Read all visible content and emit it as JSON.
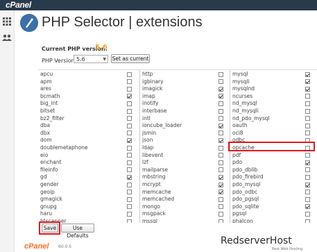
{
  "header": {
    "logo_text": "cPanel",
    "page_title": "PHP Selector | extensions"
  },
  "current": {
    "label": "Current PHP version:",
    "value": "5.6"
  },
  "version_select": {
    "label": "PHP Version",
    "selected": "5.6"
  },
  "buttons": {
    "set_current": "Set as current",
    "save": "Save",
    "use_defaults": "Use Defaults"
  },
  "columns": [
    [
      {
        "name": "apcu",
        "checked": false
      },
      {
        "name": "apm",
        "checked": false
      },
      {
        "name": "ares",
        "checked": false
      },
      {
        "name": "bcmath",
        "checked": true
      },
      {
        "name": "big_int",
        "checked": false
      },
      {
        "name": "bitset",
        "checked": false
      },
      {
        "name": "bz2_filter",
        "checked": false
      },
      {
        "name": "dba",
        "checked": false
      },
      {
        "name": "dbx",
        "checked": false
      },
      {
        "name": "dom",
        "checked": true
      },
      {
        "name": "doublemetaphone",
        "checked": false
      },
      {
        "name": "eio",
        "checked": false
      },
      {
        "name": "enchant",
        "checked": false
      },
      {
        "name": "fileinfo",
        "checked": false
      },
      {
        "name": "gd",
        "checked": true
      },
      {
        "name": "gender",
        "checked": false
      },
      {
        "name": "geoip",
        "checked": false
      },
      {
        "name": "gmagick",
        "checked": false
      },
      {
        "name": "gnupg",
        "checked": false
      },
      {
        "name": "haru",
        "checked": false
      },
      {
        "name": "htscanner",
        "checked": false
      }
    ],
    [
      {
        "name": "http",
        "checked": false
      },
      {
        "name": "igbinary",
        "checked": false
      },
      {
        "name": "imagick",
        "checked": true
      },
      {
        "name": "imap",
        "checked": true
      },
      {
        "name": "inotify",
        "checked": false
      },
      {
        "name": "interbase",
        "checked": false
      },
      {
        "name": "intl",
        "checked": false
      },
      {
        "name": "ioncube_loader",
        "checked": true
      },
      {
        "name": "jsmin",
        "checked": false
      },
      {
        "name": "json",
        "checked": true
      },
      {
        "name": "ldap",
        "checked": false
      },
      {
        "name": "libevent",
        "checked": false
      },
      {
        "name": "lzf",
        "checked": false
      },
      {
        "name": "mailparse",
        "checked": false
      },
      {
        "name": "mbstring",
        "checked": true
      },
      {
        "name": "mcrypt",
        "checked": true
      },
      {
        "name": "memcache",
        "checked": true
      },
      {
        "name": "memcached",
        "checked": false
      },
      {
        "name": "mongo",
        "checked": false
      },
      {
        "name": "msgpack",
        "checked": false
      },
      {
        "name": "mssql",
        "checked": false
      }
    ],
    [
      {
        "name": "mysql",
        "checked": true
      },
      {
        "name": "mysqli",
        "checked": true
      },
      {
        "name": "mysqlnd",
        "checked": true
      },
      {
        "name": "ncurses",
        "checked": false
      },
      {
        "name": "nd_mysql",
        "checked": false
      },
      {
        "name": "nd_mysqli",
        "checked": false
      },
      {
        "name": "nd_pdo_mysql",
        "checked": false
      },
      {
        "name": "oauth",
        "checked": false
      },
      {
        "name": "oci8",
        "checked": false
      },
      {
        "name": "odbc",
        "checked": false
      },
      {
        "name": "opcache",
        "checked": false
      },
      {
        "name": "pdf",
        "checked": false
      },
      {
        "name": "pdo",
        "checked": true
      },
      {
        "name": "pdo_dblib",
        "checked": false
      },
      {
        "name": "pdo_firebird",
        "checked": false
      },
      {
        "name": "pdo_mysql",
        "checked": true
      },
      {
        "name": "pdo_odbc",
        "checked": false
      },
      {
        "name": "pdo_pgsql",
        "checked": false
      },
      {
        "name": "pdo_sqlite",
        "checked": true
      },
      {
        "name": "pgsql",
        "checked": false
      },
      {
        "name": "phalcon",
        "checked": false
      }
    ]
  ],
  "footer": {
    "logo_text": "cPanel",
    "version": "60.0.5"
  },
  "watermark": {
    "text": "RedserverHost",
    "sub": "Best Web Hosting"
  },
  "colors": {
    "topbar": "#293a4a",
    "accent": "#f5a623",
    "highlight": "#e3171d",
    "footer_logo": "#ff6c2c"
  }
}
